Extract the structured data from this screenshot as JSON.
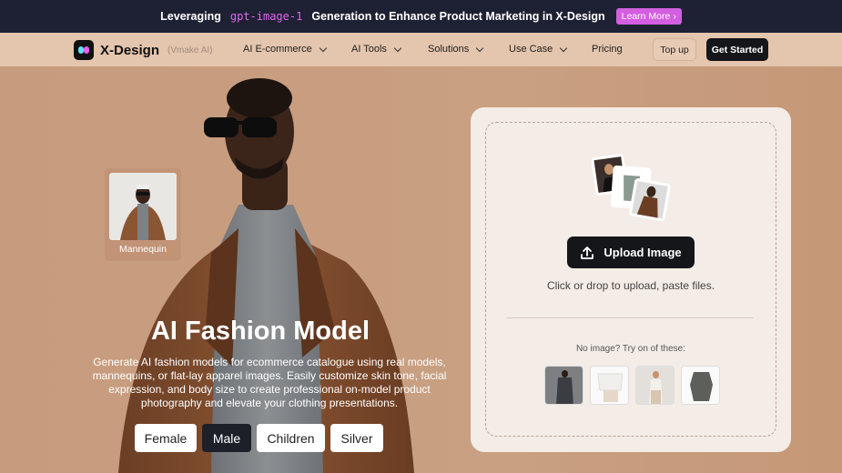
{
  "announcement": {
    "prefix": "Leveraging",
    "highlight": "gpt-image-1",
    "suffix": "Generation to Enhance Product Marketing in X-Design",
    "cta": "Learn More"
  },
  "nav": {
    "logo": "X-Design",
    "logo_sub": "(Vmake AI)",
    "items": [
      {
        "label": "AI E-commerce"
      },
      {
        "label": "AI Tools"
      },
      {
        "label": "Solutions"
      },
      {
        "label": "Use Case"
      },
      {
        "label": "Pricing"
      }
    ],
    "top_up": "Top up",
    "get_started": "Get Started"
  },
  "hero": {
    "mannequin_label": "Mannequin",
    "title": "AI Fashion Model",
    "description": "Generate AI fashion models for ecommerce catalogue using real models, mannequins, or flat-lay apparel images. Easily customize skin tone, facial expression, and body size to create professional on-model product photography and elevate your clothing presentations.",
    "genders": [
      {
        "label": "Female",
        "active": false
      },
      {
        "label": "Male",
        "active": true
      },
      {
        "label": "Children",
        "active": false
      },
      {
        "label": "Silver",
        "active": false
      }
    ]
  },
  "upload": {
    "button": "Upload Image",
    "hint": "Click or drop to upload, paste files.",
    "try_label": "No image? Try on of these:"
  },
  "colors": {
    "announce_bg": "#1e2133",
    "accent": "#d35ee0",
    "nav_bg": "#e4c5ad",
    "dark_button": "#15161a"
  }
}
